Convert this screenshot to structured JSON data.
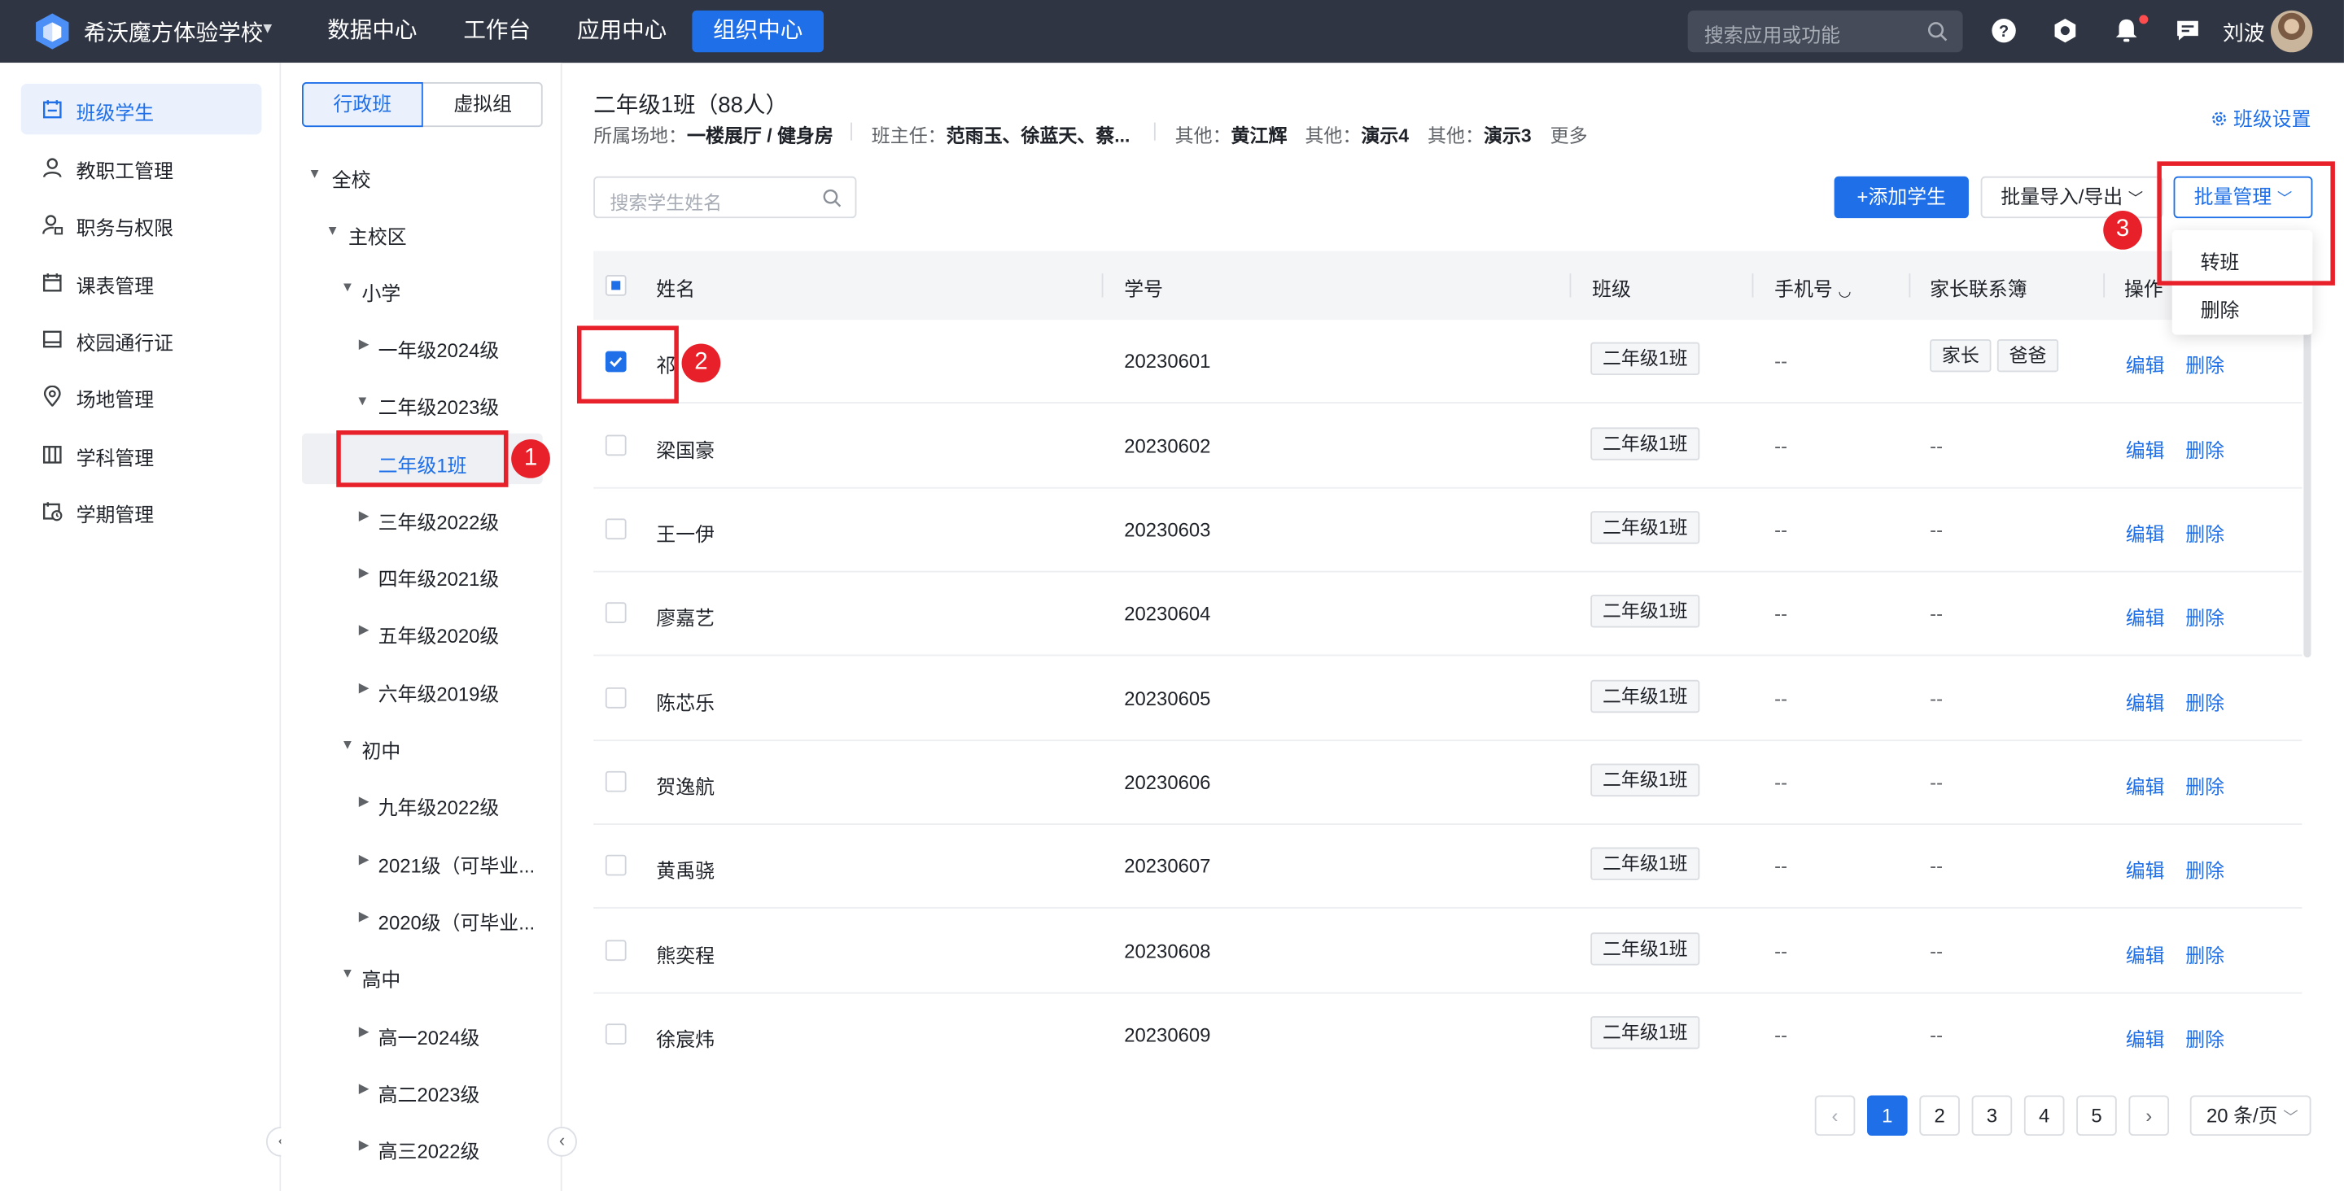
{
  "topbar": {
    "school_name": "希沃魔方体验学校",
    "nav": [
      "数据中心",
      "工作台",
      "应用中心",
      "组织中心"
    ],
    "active_nav": "组织中心",
    "search_placeholder": "搜索应用或功能",
    "username": "刘波"
  },
  "sidebar": {
    "items": [
      {
        "label": "班级学生",
        "icon": "class-icon",
        "active": true
      },
      {
        "label": "教职工管理",
        "icon": "person-icon"
      },
      {
        "label": "职务与权限",
        "icon": "user-lock-icon"
      },
      {
        "label": "课表管理",
        "icon": "calendar-icon"
      },
      {
        "label": "校园通行证",
        "icon": "card-icon"
      },
      {
        "label": "场地管理",
        "icon": "location-icon"
      },
      {
        "label": "学科管理",
        "icon": "book-icon"
      },
      {
        "label": "学期管理",
        "icon": "calendar-clock-icon"
      }
    ]
  },
  "tree": {
    "tabs": [
      "行政班",
      "虚拟组"
    ],
    "active_tab": "行政班",
    "nodes": [
      {
        "label": "全校",
        "level": 0,
        "expanded": true
      },
      {
        "label": "主校区",
        "level": 1,
        "expanded": true
      },
      {
        "label": "小学",
        "level": 2,
        "expanded": true
      },
      {
        "label": "一年级2024级",
        "level": 3,
        "expanded": false
      },
      {
        "label": "二年级2023级",
        "level": 3,
        "expanded": true
      },
      {
        "label": "二年级1班",
        "level": 4,
        "selected": true
      },
      {
        "label": "三年级2022级",
        "level": 3,
        "expanded": false
      },
      {
        "label": "四年级2021级",
        "level": 3,
        "expanded": false
      },
      {
        "label": "五年级2020级",
        "level": 3,
        "expanded": false
      },
      {
        "label": "六年级2019级",
        "level": 3,
        "expanded": false
      },
      {
        "label": "初中",
        "level": 2,
        "expanded": true
      },
      {
        "label": "九年级2022级",
        "level": 3,
        "expanded": false
      },
      {
        "label": "2021级（可毕业...",
        "level": 3,
        "expanded": false
      },
      {
        "label": "2020级（可毕业...",
        "level": 3,
        "expanded": false
      },
      {
        "label": "高中",
        "level": 2,
        "expanded": true
      },
      {
        "label": "高一2024级",
        "level": 3,
        "expanded": false
      },
      {
        "label": "高二2023级",
        "level": 3,
        "expanded": false
      },
      {
        "label": "高三2022级",
        "level": 3,
        "expanded": false
      }
    ]
  },
  "header": {
    "class_title": "二年级1班（88人）",
    "venue_label": "所属场地：",
    "venue": "一楼展厅 / 健身房",
    "teacher_label": "班主任：",
    "teachers": "范雨玉、徐蓝天、蔡...",
    "other1_label": "其他：",
    "other1": "黄江辉",
    "other2_label": "其他：",
    "other2": "演示4",
    "other3_label": "其他：",
    "other3": "演示3",
    "more": "更多",
    "settings": "班级设置"
  },
  "toolbar": {
    "search_placeholder": "搜索学生姓名",
    "add_student": "+添加学生",
    "import_export": "批量导入/导出",
    "batch_manage": "批量管理"
  },
  "dropdown": {
    "items": [
      "转班",
      "删除"
    ]
  },
  "table": {
    "columns": [
      "姓名",
      "学号",
      "班级",
      "手机号",
      "家长联系簿",
      "操作"
    ],
    "rows": [
      {
        "name": "祁",
        "id": "20230601",
        "class": "二年级1班",
        "phone": "--",
        "parents": [
          "家长",
          "爸爸"
        ],
        "checked": true
      },
      {
        "name": "梁国豪",
        "id": "20230602",
        "class": "二年级1班",
        "phone": "--",
        "parents_text": "--"
      },
      {
        "name": "王一伊",
        "id": "20230603",
        "class": "二年级1班",
        "phone": "--",
        "parents_text": "--"
      },
      {
        "name": "廖嘉艺",
        "id": "20230604",
        "class": "二年级1班",
        "phone": "--",
        "parents_text": "--"
      },
      {
        "name": "陈芯乐",
        "id": "20230605",
        "class": "二年级1班",
        "phone": "--",
        "parents_text": "--"
      },
      {
        "name": "贺逸航",
        "id": "20230606",
        "class": "二年级1班",
        "phone": "--",
        "parents_text": "--"
      },
      {
        "name": "黄禹骁",
        "id": "20230607",
        "class": "二年级1班",
        "phone": "--",
        "parents_text": "--"
      },
      {
        "name": "熊奕程",
        "id": "20230608",
        "class": "二年级1班",
        "phone": "--",
        "parents_text": "--"
      },
      {
        "name": "徐宸炜",
        "id": "20230609",
        "class": "二年级1班",
        "phone": "--",
        "parents_text": "--"
      }
    ],
    "action_edit": "编辑",
    "action_delete": "删除"
  },
  "pagination": {
    "pages": [
      "1",
      "2",
      "3",
      "4",
      "5"
    ],
    "current": "1",
    "page_size": "20 条/页"
  },
  "annotations": [
    "1",
    "2",
    "3"
  ],
  "colors": {
    "accent": "#1e6fe8",
    "topbar": "#2f3542",
    "annotation": "#e8202a"
  }
}
